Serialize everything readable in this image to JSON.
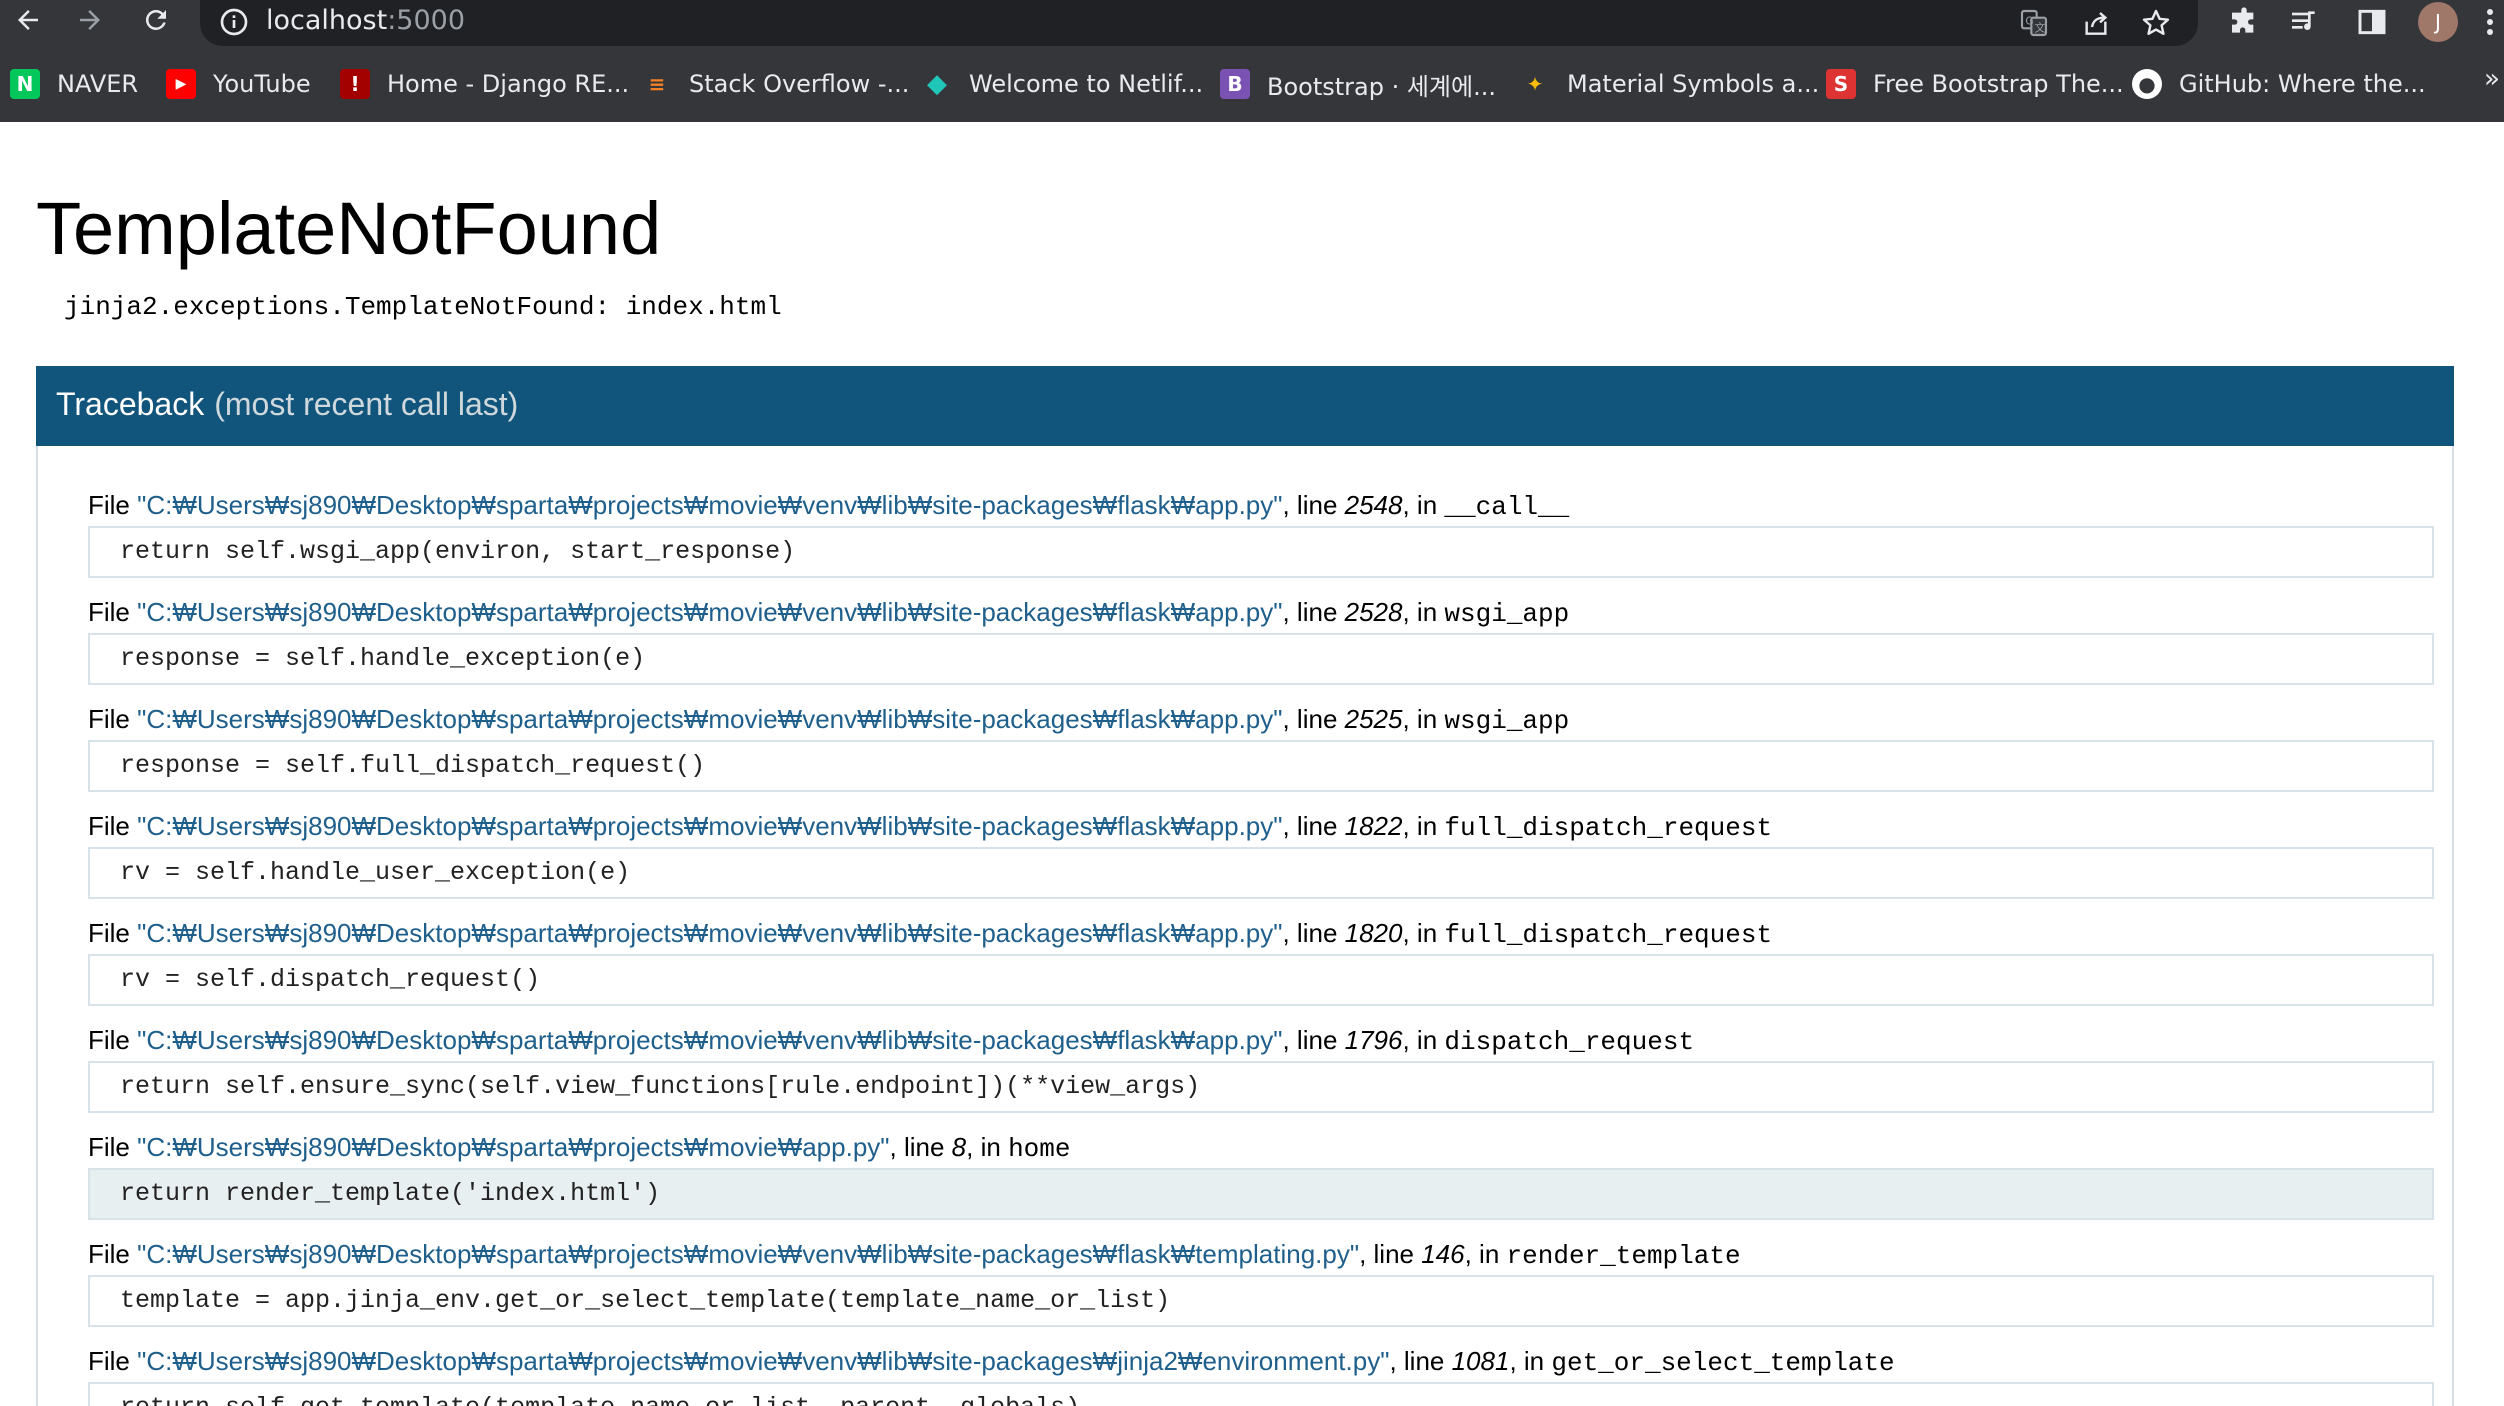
{
  "browser": {
    "url_host": "localhost",
    "url_port": ":5000",
    "profile_initial": "J",
    "bookmarks": [
      {
        "label": "NAVER",
        "icon": "naver-icon",
        "color": "#03c75a",
        "glyph": "N"
      },
      {
        "label": "YouTube",
        "icon": "youtube-icon",
        "color": "#ff0000",
        "glyph": "▶"
      },
      {
        "label": "Home - Django RE...",
        "icon": "django-rest-icon",
        "color": "#a30000",
        "glyph": "!"
      },
      {
        "label": "Stack Overflow -...",
        "icon": "stackoverflow-icon",
        "color": "#f48024",
        "glyph": "≡"
      },
      {
        "label": "Welcome to Netlif...",
        "icon": "netlify-icon",
        "color": "#20c6b7",
        "glyph": "◆"
      },
      {
        "label": "Bootstrap · 세계에...",
        "icon": "bootstrap-icon",
        "color": "#7952b3",
        "glyph": "B"
      },
      {
        "label": "Material Symbols a...",
        "icon": "material-icon",
        "color": "#4285f4",
        "glyph": "✦"
      },
      {
        "label": "Free Bootstrap The...",
        "icon": "startbootstrap-icon",
        "color": "#dd3333",
        "glyph": "S"
      },
      {
        "label": "GitHub: Where the...",
        "icon": "github-icon",
        "color": "#ffffff",
        "glyph": "●"
      }
    ],
    "more_bookmarks": "»"
  },
  "error": {
    "title": "TemplateNotFound",
    "message": "jinja2.exceptions.TemplateNotFound: index.html"
  },
  "traceback": {
    "heading": "Traceback",
    "subheading": "(most recent call last)",
    "frames": [
      {
        "file_prefix": "File ",
        "path": "\"C:₩Users₩sj890₩Desktop₩sparta₩projects₩movie₩venv₩lib₩site-packages₩flask₩app.py\"",
        "line_prefix": ", line ",
        "line": "2548",
        "in_prefix": ", in ",
        "function": "__call__",
        "code": "return self.wsgi_app(environ, start_response)",
        "current": false
      },
      {
        "file_prefix": "File ",
        "path": "\"C:₩Users₩sj890₩Desktop₩sparta₩projects₩movie₩venv₩lib₩site-packages₩flask₩app.py\"",
        "line_prefix": ", line ",
        "line": "2528",
        "in_prefix": ", in ",
        "function": "wsgi_app",
        "code": "response = self.handle_exception(e)",
        "current": false
      },
      {
        "file_prefix": "File ",
        "path": "\"C:₩Users₩sj890₩Desktop₩sparta₩projects₩movie₩venv₩lib₩site-packages₩flask₩app.py\"",
        "line_prefix": ", line ",
        "line": "2525",
        "in_prefix": ", in ",
        "function": "wsgi_app",
        "code": "response = self.full_dispatch_request()",
        "current": false
      },
      {
        "file_prefix": "File ",
        "path": "\"C:₩Users₩sj890₩Desktop₩sparta₩projects₩movie₩venv₩lib₩site-packages₩flask₩app.py\"",
        "line_prefix": ", line ",
        "line": "1822",
        "in_prefix": ", in ",
        "function": "full_dispatch_request",
        "code": "rv = self.handle_user_exception(e)",
        "current": false
      },
      {
        "file_prefix": "File ",
        "path": "\"C:₩Users₩sj890₩Desktop₩sparta₩projects₩movie₩venv₩lib₩site-packages₩flask₩app.py\"",
        "line_prefix": ", line ",
        "line": "1820",
        "in_prefix": ", in ",
        "function": "full_dispatch_request",
        "code": "rv = self.dispatch_request()",
        "current": false
      },
      {
        "file_prefix": "File ",
        "path": "\"C:₩Users₩sj890₩Desktop₩sparta₩projects₩movie₩venv₩lib₩site-packages₩flask₩app.py\"",
        "line_prefix": ", line ",
        "line": "1796",
        "in_prefix": ", in ",
        "function": "dispatch_request",
        "code": "return self.ensure_sync(self.view_functions[rule.endpoint])(**view_args)",
        "current": false
      },
      {
        "file_prefix": "File ",
        "path": "\"C:₩Users₩sj890₩Desktop₩sparta₩projects₩movie₩app.py\"",
        "line_prefix": ", line ",
        "line": "8",
        "in_prefix": ", in ",
        "function": "home",
        "code": "return render_template('index.html')",
        "current": true
      },
      {
        "file_prefix": "File ",
        "path": "\"C:₩Users₩sj890₩Desktop₩sparta₩projects₩movie₩venv₩lib₩site-packages₩flask₩templating.py\"",
        "line_prefix": ", line ",
        "line": "146",
        "in_prefix": ", in ",
        "function": "render_template",
        "code": "template = app.jinja_env.get_or_select_template(template_name_or_list)",
        "current": false
      },
      {
        "file_prefix": "File ",
        "path": "\"C:₩Users₩sj890₩Desktop₩sparta₩projects₩movie₩venv₩lib₩site-packages₩jinja2₩environment.py\"",
        "line_prefix": ", line ",
        "line": "1081",
        "in_prefix": ", in ",
        "function": "get_or_select_template",
        "code": "return self.get_template(template_name_or_list, parent, globals)",
        "current": false
      }
    ]
  }
}
